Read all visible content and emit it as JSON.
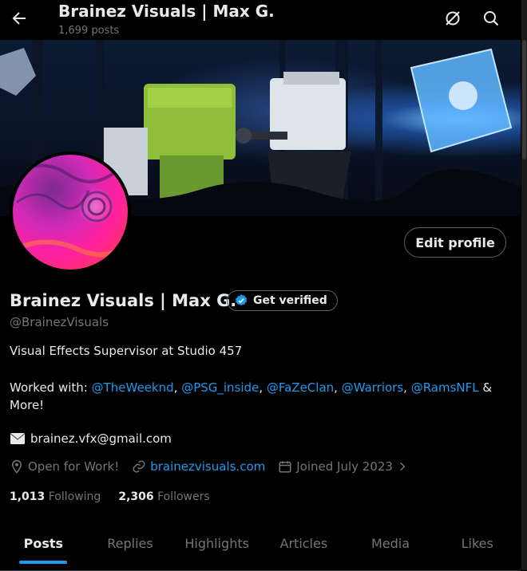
{
  "header": {
    "title": "Brainez Visuals | Max G.",
    "post_count": "1,699 posts"
  },
  "profile": {
    "display_name": "Brainez Visuals | Max G.",
    "get_verified_label": "Get verified",
    "handle": "@BrainezVisuals",
    "edit_profile_label": "Edit profile",
    "bio_line1": "Visual Effects Supervisor at Studio 457",
    "bio_prefix": "Worked with: ",
    "bio_mentions": [
      "@TheWeeknd",
      "@PSG_inside",
      "@FaZeClan",
      "@Warriors",
      "@RamsNFL"
    ],
    "bio_sep": ", ",
    "bio_suffix": " & More!",
    "email": "brainez.vfx@gmail.com",
    "location": "Open for Work!",
    "website": "brainezvisuals.com",
    "joined": "Joined July 2023",
    "following_count": "1,013",
    "following_label": "Following",
    "followers_count": "2,306",
    "followers_label": "Followers"
  },
  "tabs": [
    {
      "label": "Posts",
      "active": true
    },
    {
      "label": "Replies"
    },
    {
      "label": "Highlights"
    },
    {
      "label": "Articles"
    },
    {
      "label": "Media"
    },
    {
      "label": "Likes"
    }
  ],
  "colors": {
    "accent": "#1d9bf0",
    "background": "#000000",
    "muted": "#71767b"
  },
  "icons": [
    "back-arrow-icon",
    "circle-slash-icon",
    "search-icon",
    "verified-badge-icon",
    "envelope-icon",
    "location-icon",
    "link-icon",
    "calendar-icon",
    "chevron-right-icon"
  ]
}
